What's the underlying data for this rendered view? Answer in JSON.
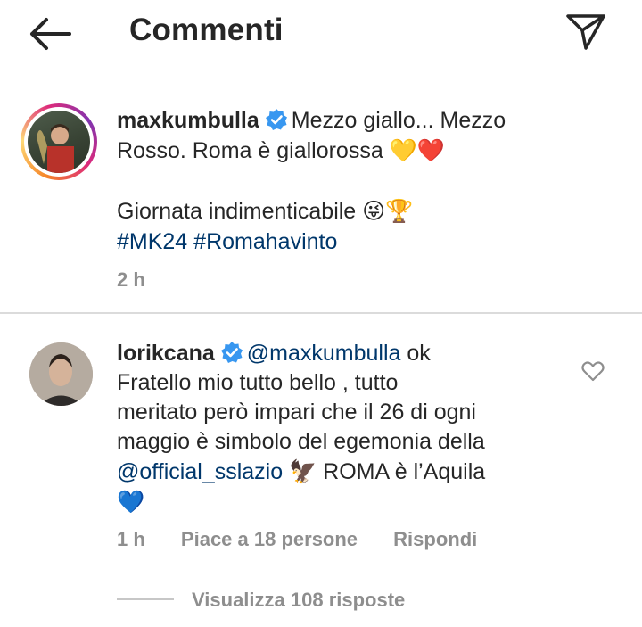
{
  "header": {
    "title": "Commenti",
    "back_icon": "arrow-left-icon",
    "send_icon": "paper-plane-icon"
  },
  "post": {
    "username": "maxkumbulla",
    "caption_line1": "Mezzo giallo... Mezzo",
    "caption_line2": "Rosso. Roma è giallorossa",
    "caption_line2_emoji": "💛❤️",
    "caption_line3": "Giornata indimenticabile",
    "caption_line3_emoji": "😜🏆",
    "hashtag1": "#MK24",
    "hashtag2": "#Romahavinto",
    "time": "2 h"
  },
  "comment": {
    "username": "lorikcana",
    "mention": "@maxkumbulla",
    "text_after_mention": " ok",
    "line2": "Fratello mio  tutto bello , tutto",
    "line3": "meritato però impari che il 26 di ogni",
    "line4": "maggio è simbolo del egemonia della",
    "mention2": "@official_sslazio",
    "eagle_emoji": "🦅",
    "line5_rest": " ROMA è l’Aquila",
    "blue_heart": "💙",
    "time": "1 h",
    "likes": "Piace a 18 persone",
    "reply": "Rispondi",
    "view_replies": "Visualizza 108 risposte"
  },
  "colors": {
    "text": "#262626",
    "meta": "#8e8e8e",
    "link": "#00376b",
    "verified": "#3897f0",
    "divider": "#dbdbdb"
  }
}
